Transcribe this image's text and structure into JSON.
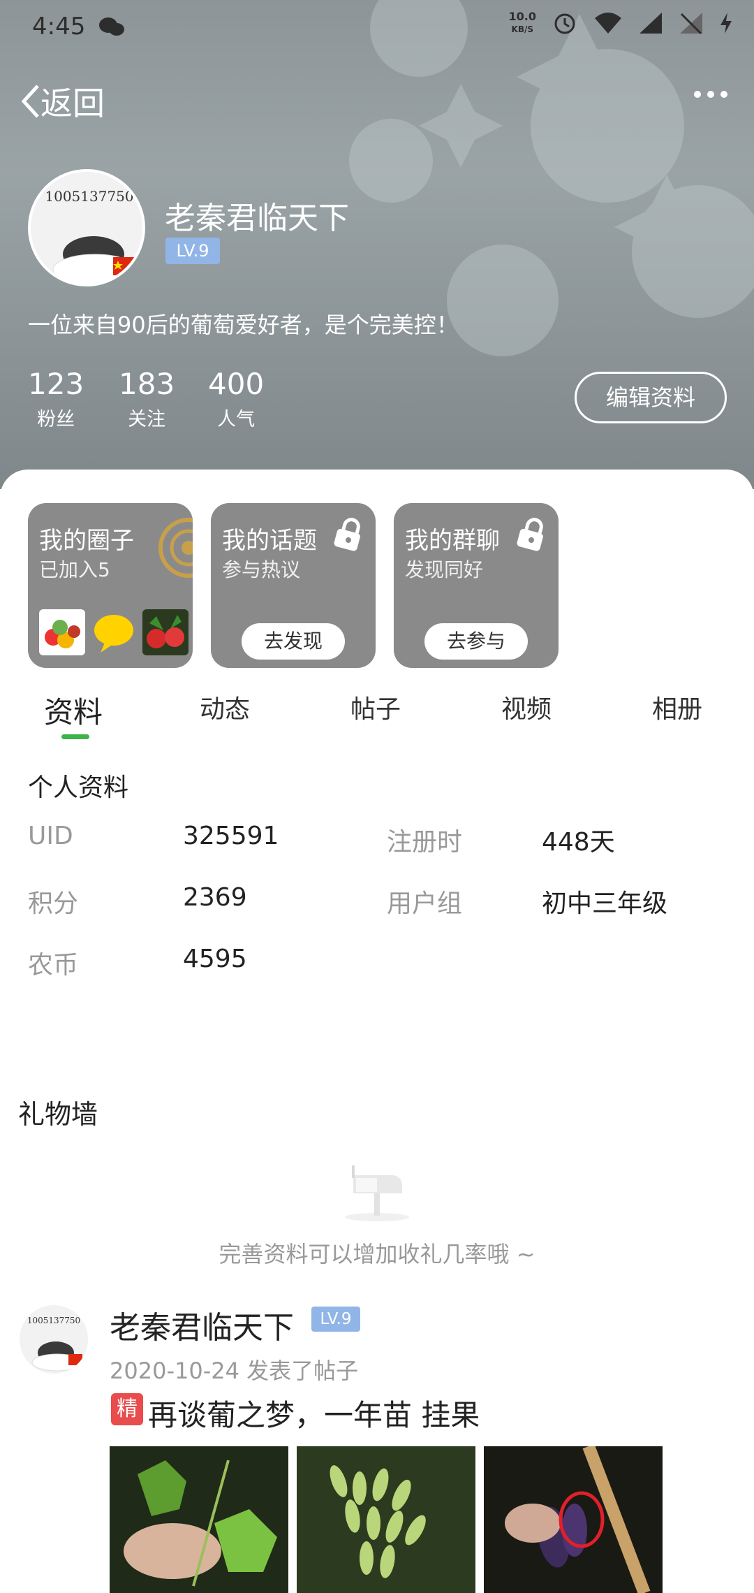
{
  "statusbar": {
    "time": "4:45",
    "speed_value": "10.0",
    "speed_unit": "KB/S"
  },
  "nav": {
    "back_label": "返回"
  },
  "profile": {
    "name": "老秦君临天下",
    "level": "LV.9",
    "avatar_caption": "1005137750",
    "bio": "一位来自90后的葡萄爱好者，是个完美控！",
    "stats": [
      {
        "value": "123",
        "label": "粉丝"
      },
      {
        "value": "183",
        "label": "关注"
      },
      {
        "value": "400",
        "label": "人气"
      }
    ],
    "edit_label": "编辑资料"
  },
  "cards": [
    {
      "title": "我的圈子",
      "subtitle": "已加入5"
    },
    {
      "title": "我的话题",
      "subtitle": "参与热议",
      "button": "去发现"
    },
    {
      "title": "我的群聊",
      "subtitle": "发现同好",
      "button": "去参与"
    }
  ],
  "tabs": [
    "资料",
    "动态",
    "帖子",
    "视频",
    "相册"
  ],
  "personal": {
    "title": "个人资料",
    "fields": [
      {
        "label": "UID",
        "value": "325591"
      },
      {
        "label": "注册时",
        "value": "448天"
      },
      {
        "label": "积分",
        "value": "2369"
      },
      {
        "label": "用户组",
        "value": "初中三年级"
      },
      {
        "label": "农币",
        "value": "4595"
      }
    ]
  },
  "gift_wall": {
    "title": "礼物墙",
    "tip": "完善资料可以增加收礼几率哦 ~"
  },
  "post": {
    "author": "老秦君临天下",
    "level": "LV.9",
    "meta": "2020-10-24 发表了帖子",
    "badge": "精",
    "title": "再谈葡之梦，一年苗 挂果"
  },
  "colors": {
    "accent_green": "#3bb44a",
    "level_badge": "#92b5e8",
    "featured_badge": "#e84c4c"
  }
}
